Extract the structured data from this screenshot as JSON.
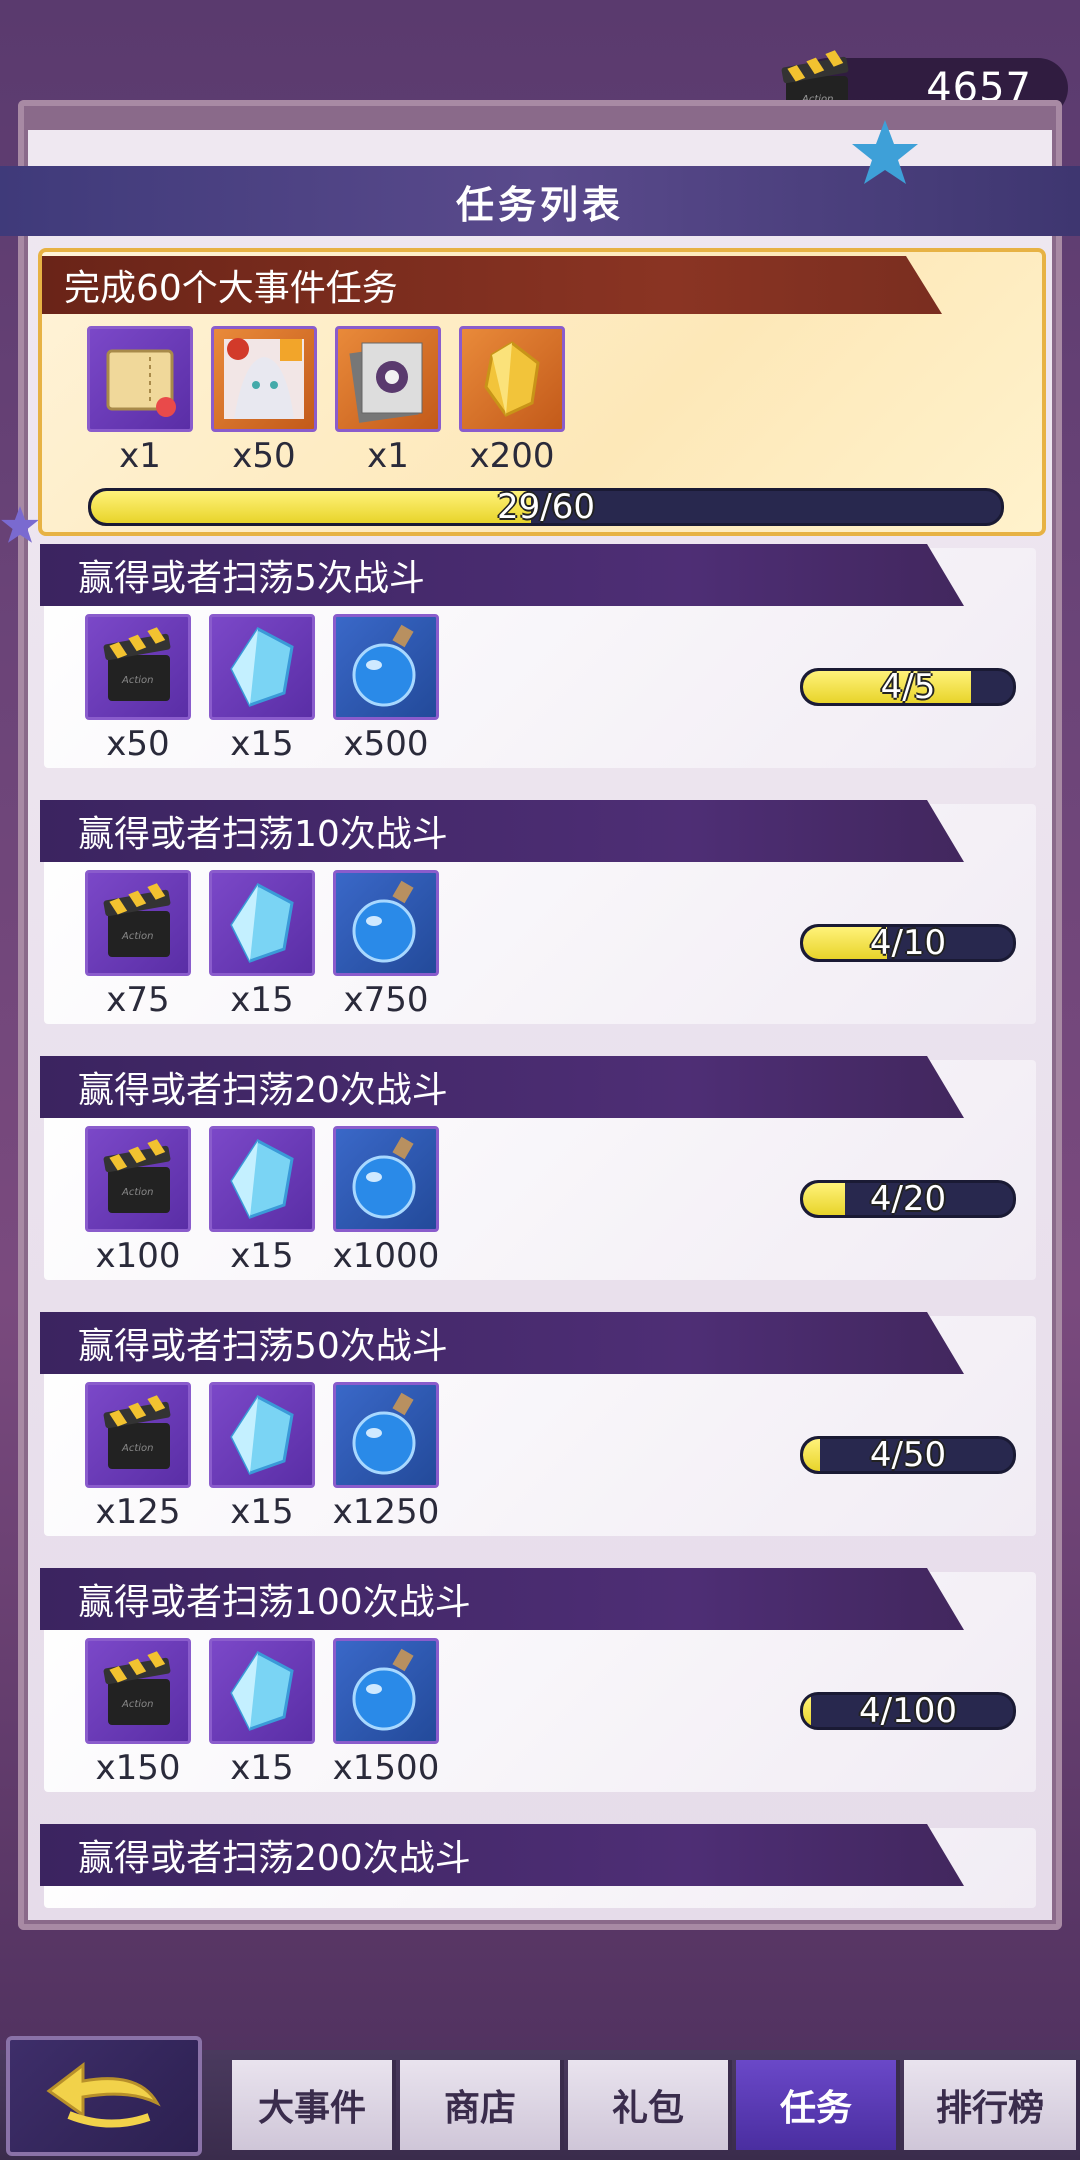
{
  "currency": {
    "value": "4657",
    "icon": "clapperboard-icon"
  },
  "header": {
    "title": "任务列表"
  },
  "main_task": {
    "title": "完成60个大事件任务",
    "rewards": [
      {
        "icon": "ticket-icon",
        "qty": "x1",
        "frame": "purple"
      },
      {
        "icon": "character-fragment-icon",
        "qty": "x50",
        "frame": "orange"
      },
      {
        "icon": "card-pack-icon",
        "qty": "x1",
        "frame": "orange"
      },
      {
        "icon": "gold-crystal-icon",
        "qty": "x200",
        "frame": "orange"
      }
    ],
    "progress": {
      "text": "29/60",
      "fraction": 0.483
    }
  },
  "tasks": [
    {
      "title": "赢得或者扫荡5次战斗",
      "rewards": [
        "x50",
        "x15",
        "x500"
      ],
      "progress": {
        "text": "4/5",
        "fraction": 0.8
      }
    },
    {
      "title": "赢得或者扫荡10次战斗",
      "rewards": [
        "x75",
        "x15",
        "x750"
      ],
      "progress": {
        "text": "4/10",
        "fraction": 0.4
      }
    },
    {
      "title": "赢得或者扫荡20次战斗",
      "rewards": [
        "x100",
        "x15",
        "x1000"
      ],
      "progress": {
        "text": "4/20",
        "fraction": 0.2
      }
    },
    {
      "title": "赢得或者扫荡50次战斗",
      "rewards": [
        "x125",
        "x15",
        "x1250"
      ],
      "progress": {
        "text": "4/50",
        "fraction": 0.08
      }
    },
    {
      "title": "赢得或者扫荡100次战斗",
      "rewards": [
        "x150",
        "x15",
        "x1500"
      ],
      "progress": {
        "text": "4/100",
        "fraction": 0.04
      }
    },
    {
      "title": "赢得或者扫荡200次战斗"
    }
  ],
  "task_reward_icons": [
    "clapperboard-icon",
    "blue-crystal-icon",
    "blue-potion-icon"
  ],
  "nav": {
    "back_icon": "back-arrow-icon",
    "items": [
      "大事件",
      "商店",
      "礼包",
      "任务",
      "排行榜"
    ],
    "active_index": 3
  },
  "colors": {
    "accent": "#5a3a8c",
    "progress_fill": "#f0de3a",
    "progress_track": "#28284e"
  }
}
